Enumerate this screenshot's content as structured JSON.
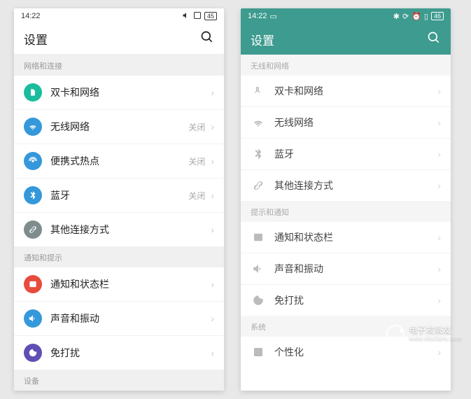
{
  "left": {
    "status": {
      "time": "14:22",
      "battery": "45"
    },
    "header": {
      "title": "设置"
    },
    "sections": [
      {
        "header": "网络和连接",
        "items": [
          {
            "icon": "sim",
            "label": "双卡和网络",
            "status": "",
            "color": "#1abc9c"
          },
          {
            "icon": "wifi",
            "label": "无线网络",
            "status": "关闭",
            "color": "#3498db"
          },
          {
            "icon": "hotspot",
            "label": "便携式热点",
            "status": "关闭",
            "color": "#3498db"
          },
          {
            "icon": "bluetooth",
            "label": "蓝牙",
            "status": "关闭",
            "color": "#3498db"
          },
          {
            "icon": "link",
            "label": "其他连接方式",
            "status": "",
            "color": "#7f8c8d"
          }
        ]
      },
      {
        "header": "通知和提示",
        "items": [
          {
            "icon": "notification",
            "label": "通知和状态栏",
            "status": "",
            "color": "#e74c3c"
          },
          {
            "icon": "sound",
            "label": "声音和振动",
            "status": "",
            "color": "#3498db"
          },
          {
            "icon": "dnd",
            "label": "免打扰",
            "status": "",
            "color": "#5d4fb3"
          }
        ]
      },
      {
        "header": "设备",
        "items": []
      }
    ]
  },
  "right": {
    "status": {
      "time": "14:22",
      "battery": "46"
    },
    "header": {
      "title": "设置"
    },
    "sections": [
      {
        "header": "无线和网络",
        "items": [
          {
            "icon": "sim",
            "label": "双卡和网络"
          },
          {
            "icon": "wifi",
            "label": "无线网络"
          },
          {
            "icon": "bluetooth",
            "label": "蓝牙"
          },
          {
            "icon": "link",
            "label": "其他连接方式"
          }
        ]
      },
      {
        "header": "提示和通知",
        "items": [
          {
            "icon": "notification",
            "label": "通知和状态栏"
          },
          {
            "icon": "sound",
            "label": "声音和振动"
          },
          {
            "icon": "dnd",
            "label": "免打扰"
          }
        ]
      },
      {
        "header": "系统",
        "items": [
          {
            "icon": "personalize",
            "label": "个性化"
          }
        ]
      }
    ]
  },
  "watermark": {
    "name": "电子发烧友",
    "url": "www.elecfans.com"
  }
}
